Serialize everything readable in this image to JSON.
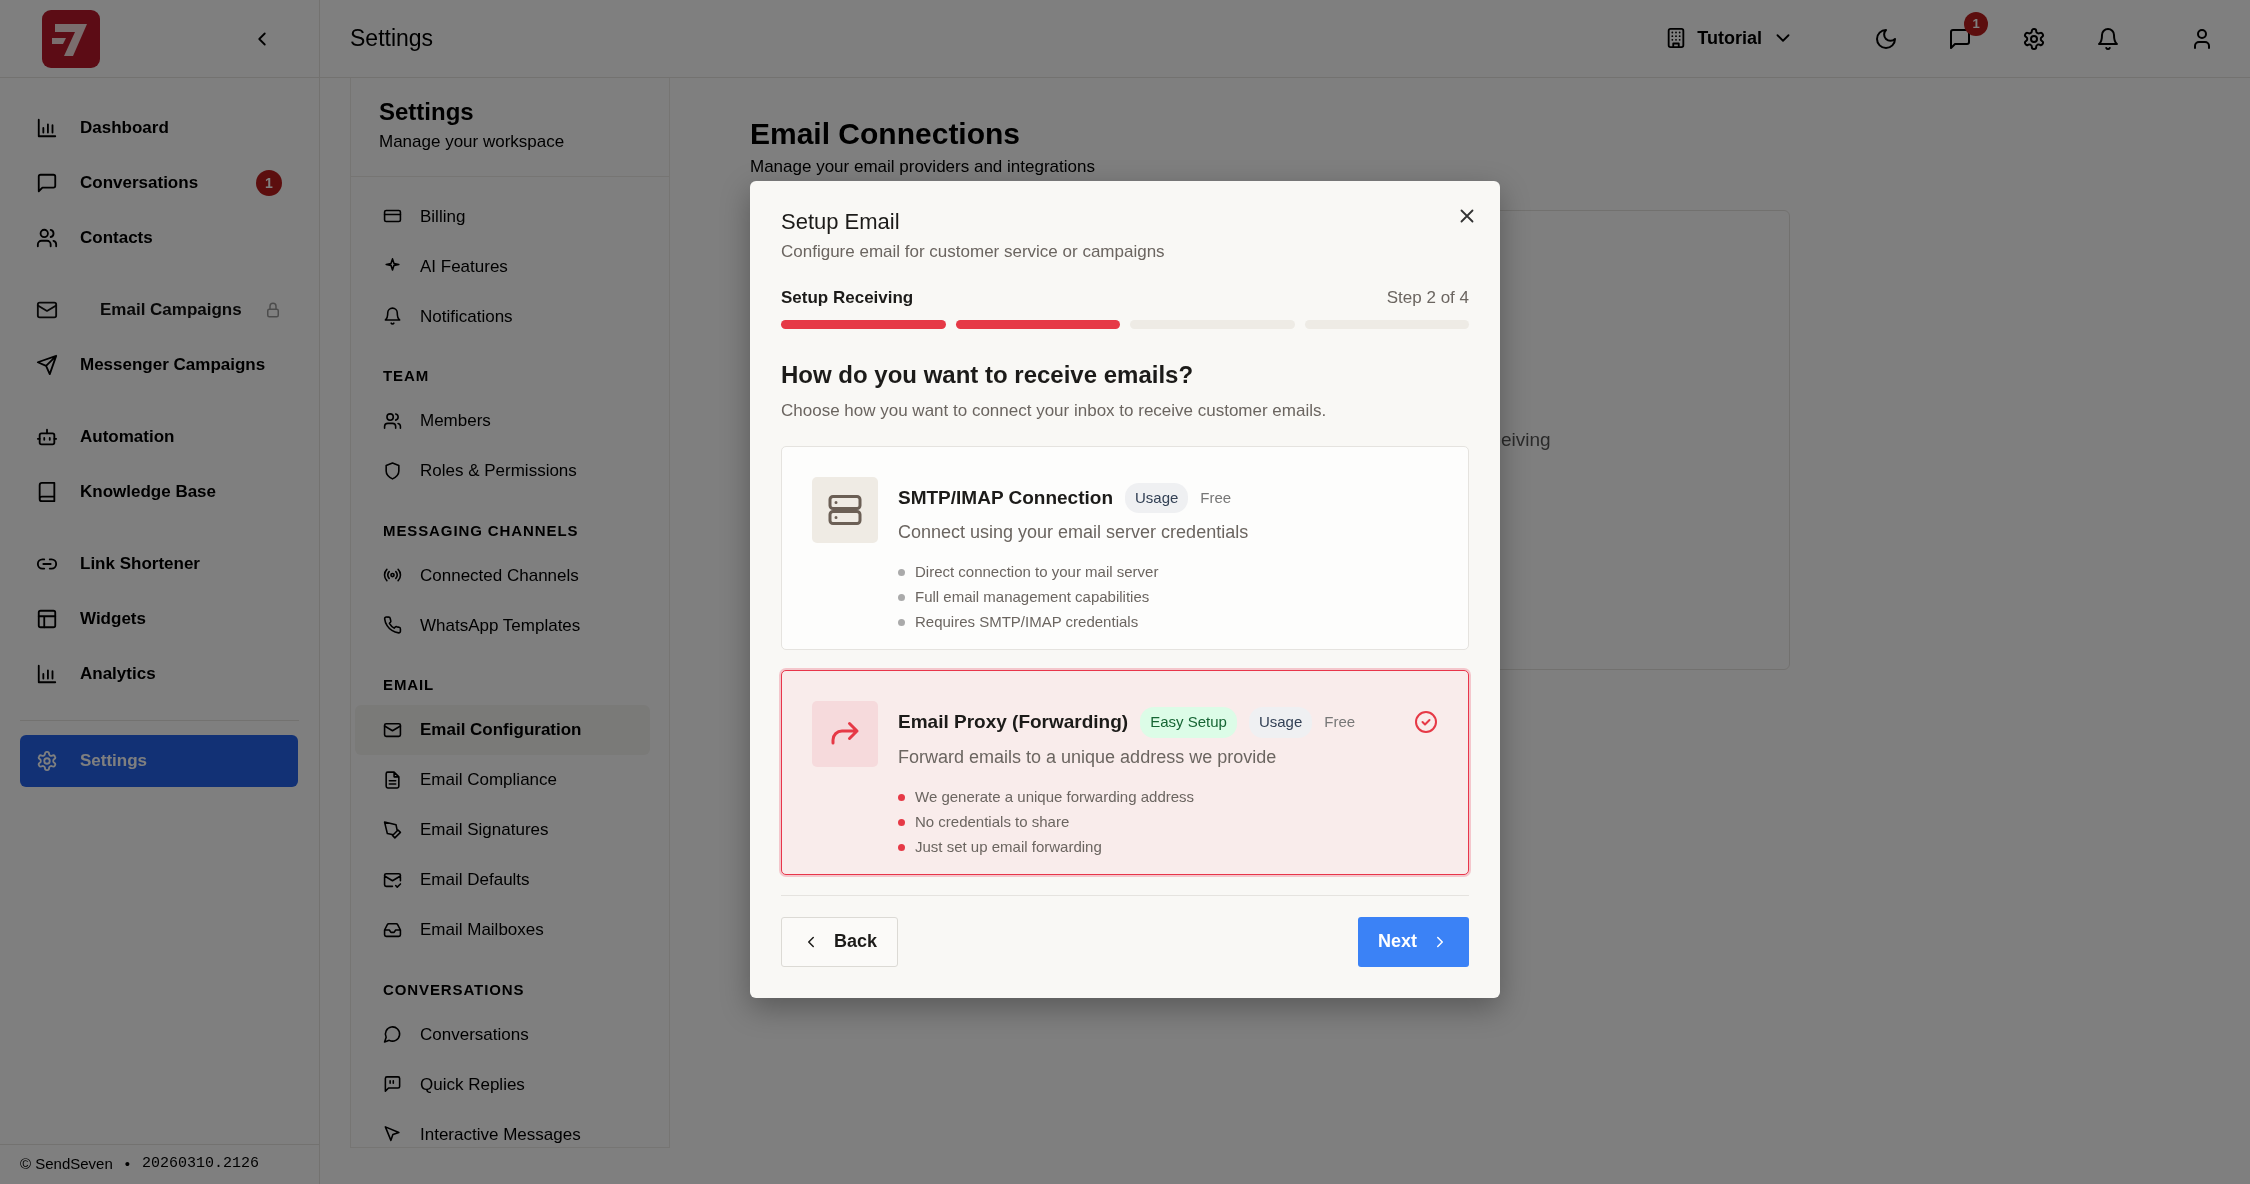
{
  "sidebar": {
    "groups": [
      [
        {
          "label": "Dashboard",
          "selected": false
        },
        {
          "label": "Conversations",
          "selected": false,
          "badge": "1"
        },
        {
          "label": "Contacts",
          "selected": false
        }
      ],
      [
        {
          "label": "Email Campaigns",
          "selected": false,
          "locked": true
        },
        {
          "label": "Messenger Campaigns",
          "selected": false
        }
      ],
      [
        {
          "label": "Automation",
          "selected": false
        },
        {
          "label": "Knowledge Base",
          "selected": false
        }
      ],
      [
        {
          "label": "Link Shortener",
          "selected": false
        },
        {
          "label": "Widgets",
          "selected": false
        },
        {
          "label": "Analytics",
          "selected": false
        }
      ],
      [
        {
          "label": "Settings",
          "selected": true
        }
      ]
    ],
    "footer": {
      "copyright": "© SendSeven",
      "separator": "•",
      "version": "20260310.2126"
    }
  },
  "top_bar": {
    "title": "Settings",
    "workspace": "Tutorial",
    "chat_badge": "1"
  },
  "settings_nav": {
    "title": "Settings",
    "subtitle": "Manage your workspace",
    "sections": [
      {
        "items": [
          {
            "label": "Billing",
            "selected": false
          },
          {
            "label": "AI Features",
            "selected": false
          },
          {
            "label": "Notifications",
            "selected": false
          }
        ]
      },
      {
        "heading": "TEAM",
        "items": [
          {
            "label": "Members",
            "selected": false
          },
          {
            "label": "Roles & Permissions",
            "selected": false
          }
        ]
      },
      {
        "heading": "MESSAGING CHANNELS",
        "items": [
          {
            "label": "Connected Channels",
            "selected": false
          },
          {
            "label": "WhatsApp Templates",
            "selected": false
          }
        ]
      },
      {
        "heading": "EMAIL",
        "items": [
          {
            "label": "Email Configuration",
            "selected": true
          },
          {
            "label": "Email Compliance",
            "selected": false
          },
          {
            "label": "Email Signatures",
            "selected": false
          },
          {
            "label": "Email Defaults",
            "selected": false
          },
          {
            "label": "Email Mailboxes",
            "selected": false
          }
        ]
      },
      {
        "heading": "CONVERSATIONS",
        "items": [
          {
            "label": "Conversations",
            "selected": false
          },
          {
            "label": "Quick Replies",
            "selected": false
          },
          {
            "label": "Interactive Messages",
            "selected": false
          }
        ]
      }
    ]
  },
  "main": {
    "title": "Email Connections",
    "subtitle": "Manage your email providers and integrations",
    "card_fragment": "eiving"
  },
  "modal": {
    "title": "Setup Email",
    "subtitle": "Configure email for customer service or campaigns",
    "step_label": "Setup Receiving",
    "step_counter": "Step 2 of 4",
    "steps": [
      {
        "complete": true
      },
      {
        "complete": true
      },
      {
        "complete": false
      },
      {
        "complete": false
      }
    ],
    "question": "How do you want to receive emails?",
    "description": "Choose how you want to connect your inbox to receive customer emails.",
    "options": [
      {
        "title": "SMTP/IMAP Connection",
        "badges": [
          {
            "label": "Usage",
            "kind": "usage"
          }
        ],
        "price": "Free",
        "description": "Connect using your email server credentials",
        "bullets": [
          "Direct connection to your mail server",
          "Full email management capabilities",
          "Requires SMTP/IMAP credentials"
        ],
        "selected": false
      },
      {
        "title": "Email Proxy (Forwarding)",
        "badges": [
          {
            "label": "Easy Setup",
            "kind": "easy"
          },
          {
            "label": "Usage",
            "kind": "usage"
          }
        ],
        "price": "Free",
        "description": "Forward emails to a unique address we provide",
        "bullets": [
          "We generate a unique forwarding address",
          "No credentials to share",
          "Just set up email forwarding"
        ],
        "selected": true
      }
    ],
    "back_button": "Back",
    "next_button": "Next"
  }
}
